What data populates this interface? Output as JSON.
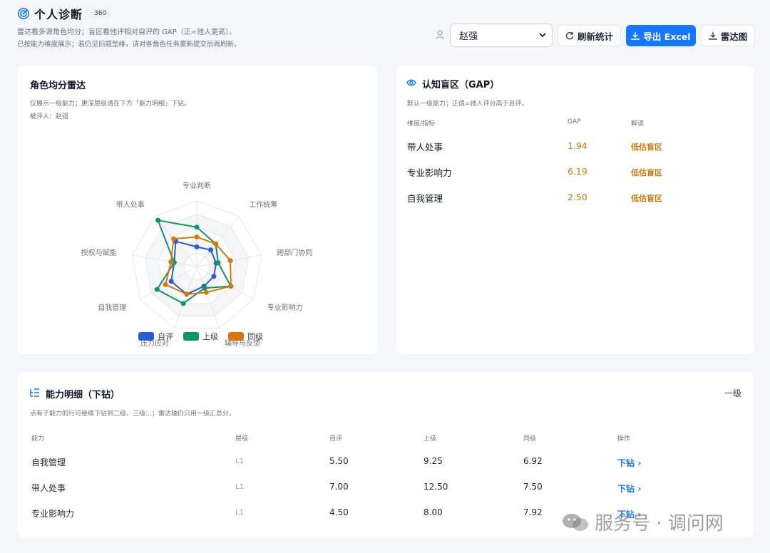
{
  "header": {
    "title": "个人诊断",
    "badge": "360",
    "subtitle1": "雷达看多源角色均分；盲区看他评相对自评的 GAP（正=他人更高）。",
    "subtitle2": "已按能力维度展示；若仍见旧题型维，请对各角色任务重新提交后再刷新。",
    "selected_person": "赵强",
    "refresh_label": "刷新统计",
    "export_label": "导出 Excel",
    "radar_label": "雷达图"
  },
  "radar_card": {
    "title": "角色均分雷达",
    "note": "仅展示一级能力；更深层级请在下方「能力明细」下钻。",
    "evaluatee": "被评人：赵强",
    "axes": [
      "专业判断",
      "工作统筹",
      "跨部门协同",
      "专业影响力",
      "辅导与反馈",
      "压力应对",
      "自我管理",
      "授权与赋能",
      "带人处事"
    ],
    "legend": [
      "自评",
      "上级",
      "同级"
    ],
    "colors": {
      "self": "#2b5bd7",
      "superior": "#0e9467",
      "peer": "#d97706"
    }
  },
  "chart_data": {
    "type": "radar",
    "categories": [
      "专业判断",
      "工作统筹",
      "跨部门协同",
      "专业影响力",
      "辅导与反馈",
      "压力应对",
      "自我管理",
      "授权与赋能",
      "带人处事"
    ],
    "series": [
      {
        "name": "自评",
        "values": [
          0.3,
          0.33,
          0.3,
          0.3,
          0.32,
          0.45,
          0.45,
          0.35,
          0.5
        ]
      },
      {
        "name": "上级",
        "values": [
          0.6,
          0.45,
          0.33,
          0.6,
          0.35,
          0.6,
          0.7,
          0.35,
          0.92
        ]
      },
      {
        "name": "同级",
        "values": [
          0.45,
          0.45,
          0.52,
          0.6,
          0.42,
          0.45,
          0.55,
          0.4,
          0.55
        ]
      }
    ]
  },
  "gap_card": {
    "title": "认知盲区（GAP）",
    "note": "默认一级能力；正值=他人评分高于自评。",
    "col_dim": "维度/指标",
    "col_gap": "GAP",
    "col_interp": "解读",
    "rows": [
      {
        "name": "带人处事",
        "gap": "1.94",
        "interp": "低估盲区"
      },
      {
        "name": "专业影响力",
        "gap": "6.19",
        "interp": "低估盲区"
      },
      {
        "name": "自我管理",
        "gap": "2.50",
        "interp": "低估盲区"
      }
    ]
  },
  "detail_card": {
    "title": "能力明细（下钻）",
    "note": "点有子能力的行可继续下钻到二级、三级…；雷达轴仍只用一级汇总分。",
    "level": "一级",
    "headers": [
      "能力",
      "层级",
      "自评",
      "上级",
      "同级",
      "操作"
    ],
    "rows": [
      {
        "name": "自我管理",
        "level": "L1",
        "self": "5.50",
        "superior": "9.25",
        "peer": "6.92",
        "action": "下钻"
      },
      {
        "name": "带人处事",
        "level": "L1",
        "self": "7.00",
        "superior": "12.50",
        "peer": "7.50",
        "action": "下钻"
      },
      {
        "name": "专业影响力",
        "level": "L1",
        "self": "4.50",
        "superior": "8.00",
        "peer": "7.92",
        "action": "下钻"
      }
    ]
  },
  "watermark": "服务号 · 调问网"
}
